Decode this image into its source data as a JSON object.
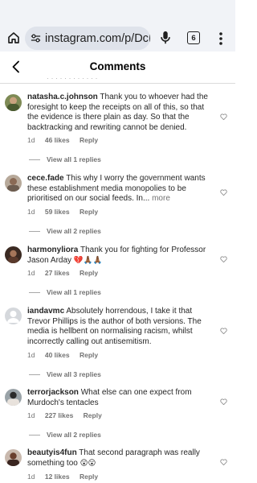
{
  "browser": {
    "url": "instagram.com/p/DcRSH",
    "tab_count": "6"
  },
  "header": {
    "title": "Comments"
  },
  "faded_text": "· · · · · · · · · · · ·",
  "comments": [
    {
      "username": "natasha.c.johnson",
      "text": "Thank you to whoever had the foresight to keep the receipts on all of this, so that the evidence is there plain as day. So that the backtracking and rewriting cannot be denied.",
      "time": "1d",
      "likes": "46 likes",
      "reply": "Reply",
      "view_replies": "View all 1 replies"
    },
    {
      "username": "cece.fade",
      "text": "This why I worry the government wants these establishment media monopolies to be prioritised on our social feeds. In...",
      "more": "more",
      "time": "1d",
      "likes": "59 likes",
      "reply": "Reply",
      "view_replies": "View all 2 replies"
    },
    {
      "username": "harmonyliora",
      "text": "Thank you for fighting for Professor Jason Arday",
      "emojis": "💔🙏🏾🙏🏾",
      "time": "1d",
      "likes": "27 likes",
      "reply": "Reply",
      "view_replies": "View all 1 replies"
    },
    {
      "username": "iandavmc",
      "text": "Absolutely horrendous, I take it that Trevor Phillips is the author of both versions. The media is hellbent on normalising racism, whilst incorrectly calling out antisemitism.",
      "time": "1d",
      "likes": "40 likes",
      "reply": "Reply",
      "view_replies": "View all 3 replies"
    },
    {
      "username": "terrorjackson",
      "text": "What else can one expect from Murdoch's tentacles",
      "time": "1d",
      "likes": "227 likes",
      "reply": "Reply",
      "view_replies": "View all 2 replies"
    },
    {
      "username": "beautyis4fun",
      "text": "That second paragraph was really something too",
      "emojis": "😲😮",
      "time": "1d",
      "likes": "12 likes",
      "reply": "Reply"
    }
  ],
  "colors": {
    "heart_outline": "#8e8e8e",
    "meta_text": "#737373",
    "browser_bg": "#f1f3f7"
  }
}
